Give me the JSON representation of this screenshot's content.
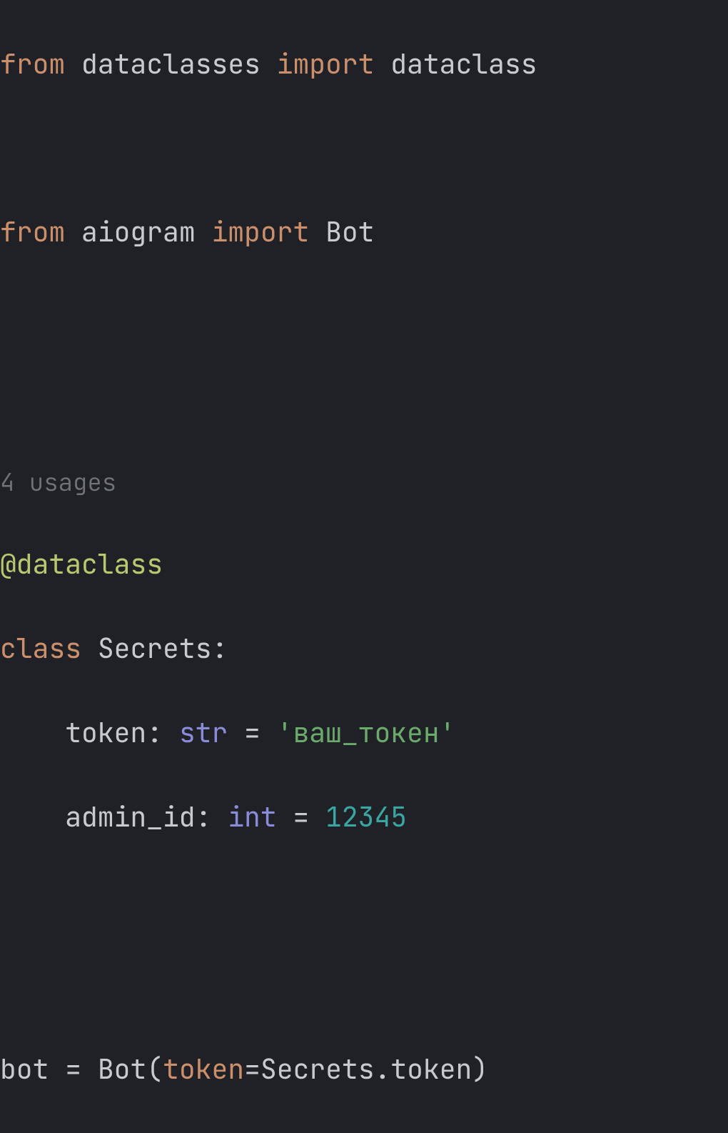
{
  "code": {
    "line1": {
      "from": "from",
      "module1": "dataclasses",
      "import": "import",
      "name1": "dataclass"
    },
    "line3": {
      "from": "from",
      "module2": "aiogram",
      "import": "import",
      "name2": "Bot"
    },
    "usages_hint": "4 usages",
    "decorator": "@dataclass",
    "class_kw": "class",
    "class_name": "Secrets",
    "colon": ":",
    "field1": {
      "name": "token",
      "type": "str",
      "value": "'ваш_токен'"
    },
    "field2": {
      "name": "admin_id",
      "type": "int",
      "value": "12345"
    },
    "assign": {
      "var": "bot",
      "eq": "=",
      "call": "Bot",
      "kwarg": "token",
      "rhs": "Secrets.token"
    }
  }
}
